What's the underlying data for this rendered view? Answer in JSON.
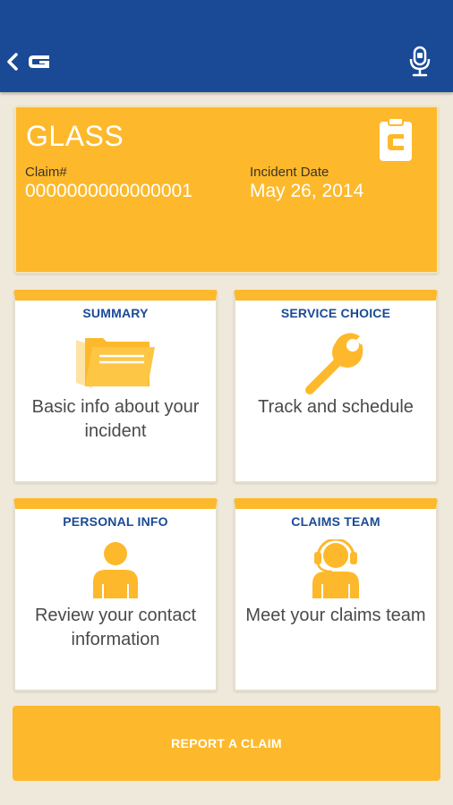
{
  "colors": {
    "header": "#1a4a96",
    "accent": "#fdb92b",
    "background": "#efe9dc",
    "tile_title": "#1a4a96"
  },
  "header": {
    "back_icon": "chevron-left-icon",
    "logo": "G",
    "mic_icon": "microphone-icon"
  },
  "claim": {
    "type": "GLASS",
    "claim_label": "Claim#",
    "claim_number": "0000000000000001",
    "date_label": "Incident Date",
    "date_value": "May 26, 2014",
    "icon": "clipboard-icon"
  },
  "tiles": [
    {
      "title": "SUMMARY",
      "description": "Basic info about your incident",
      "icon": "folder-icon"
    },
    {
      "title": "SERVICE CHOICE",
      "description": "Track and schedule",
      "icon": "wrench-icon"
    },
    {
      "title": "PERSONAL INFO",
      "description": "Review your contact information",
      "icon": "person-icon"
    },
    {
      "title": "CLAIMS TEAM",
      "description": "Meet your claims team",
      "icon": "headset-agent-icon"
    }
  ],
  "report_button": {
    "label": "REPORT A CLAIM"
  }
}
